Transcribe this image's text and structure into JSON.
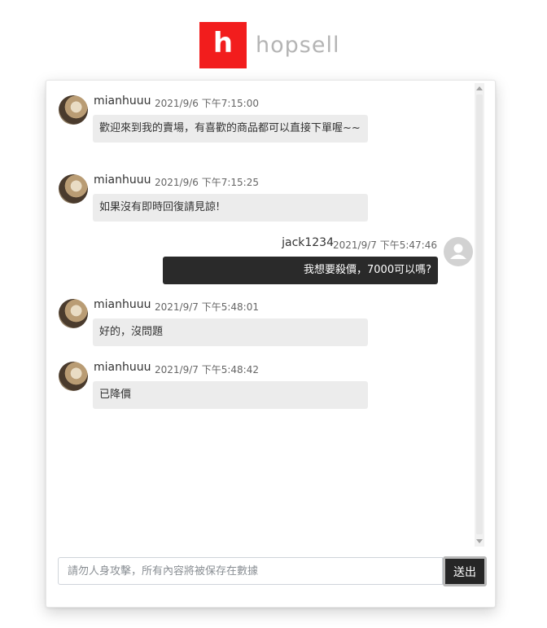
{
  "logo": {
    "letter": "h",
    "text": "hopsell"
  },
  "messages": [
    {
      "user": "mianhuuu",
      "time": "2021/9/6 下午7:15:00",
      "text": "歡迎來到我的賣場，有喜歡的商品都可以直接下單喔~~",
      "mine": false
    },
    {
      "user": "mianhuuu",
      "time": "2021/9/6 下午7:15:25",
      "text": "如果沒有即時回復請見諒!",
      "mine": false
    },
    {
      "user": "jack1234",
      "time": "2021/9/7 下午5:47:46",
      "text": "我想要殺價，7000可以嗎?",
      "mine": true
    },
    {
      "user": "mianhuuu",
      "time": "2021/9/7 下午5:48:01",
      "text": "好的，沒問題",
      "mine": false
    },
    {
      "user": "mianhuuu",
      "time": "2021/9/7 下午5:48:42",
      "text": "已降價",
      "mine": false
    }
  ],
  "input": {
    "placeholder": "請勿人身攻擊，所有內容將被保存在數據",
    "value": ""
  },
  "send_label": "送出",
  "colors": {
    "brand": "#f21d1d",
    "my_bubble": "#2a2a2a",
    "other_bubble": "#ececec"
  },
  "icons": {
    "default_avatar": "user-silhouette-icon"
  }
}
